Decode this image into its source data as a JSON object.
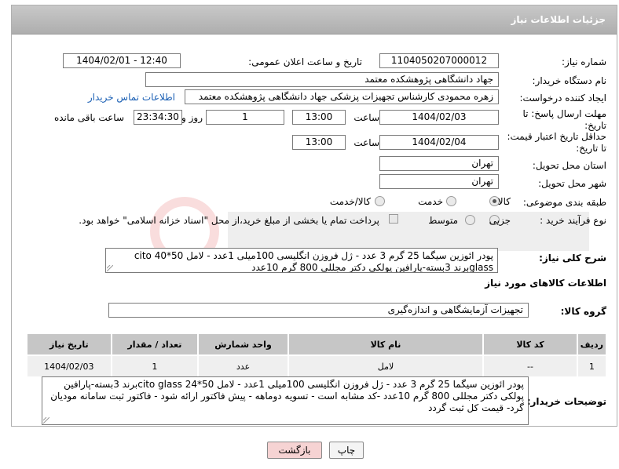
{
  "header": {
    "title": "جزئیات اطلاعات نیاز"
  },
  "form": {
    "need_number_label": "شماره نیاز:",
    "need_number": "1104050207000012",
    "announce_label": "تاریخ و ساعت اعلان عمومی:",
    "announce_value": "1404/02/01 - 12:40",
    "buyer_org_label": "نام دستگاه خریدار:",
    "buyer_org": "جهاد دانشگاهی پژوهشکده معتمد",
    "creator_label": "ایجاد کننده درخواست:",
    "creator": "زهره محمودی کارشناس تجهیزات پزشکی جهاد دانشگاهی پژوهشکده معتمد",
    "contact_link": "اطلاعات تماس خریدار",
    "deadline_label": "مهلت ارسال پاسخ: تا تاریخ:",
    "deadline_date": "1404/02/03",
    "time_label": "ساعت",
    "deadline_time": "13:00",
    "days_value": "1",
    "days_label": "روز و",
    "remaining_time": "23:34:30",
    "remaining_label": "ساعت باقی مانده",
    "validity_label": "حداقل تاریخ اعتبار قیمت: تا تاریخ:",
    "validity_date": "1404/02/04",
    "validity_time": "13:00",
    "province_label": "استان محل تحویل:",
    "province": "تهران",
    "city_label": "شهر محل تحویل:",
    "city": "تهران",
    "category_label": "طبقه بندی موضوعی:",
    "category_options": [
      "کالا",
      "خدمت",
      "کالا/خدمت"
    ],
    "process_label": "نوع فرآیند خرید :",
    "process_options": [
      "جزیی",
      "متوسط"
    ],
    "payment_note": "پرداخت تمام یا بخشی از مبلغ خرید،از محل \"اسناد خزانه اسلامی\" خواهد بود."
  },
  "summary": {
    "label": "شرح کلی نیاز:",
    "text": "پودر ائوزین سیگما 25 گرم 3 عدد - ژل فروزن انگلیسی 100میلی 1عدد - لامل 50*40 cito glassبرند 3بسته-پارافین پولکی دکتر مجللی 800 گرم 10عدد"
  },
  "goods": {
    "section_title": "اطلاعات کالاهای مورد نیاز",
    "group_label": "گروه کالا:",
    "group_value": "تجهیزات آزمایشگاهی و اندازه‌گیری",
    "columns": [
      "ردیف",
      "کد کالا",
      "نام کالا",
      "واحد شمارش",
      "تعداد / مقدار",
      "تاریخ نیاز"
    ],
    "rows": [
      [
        "1",
        "--",
        "لامل",
        "عدد",
        "1",
        "1404/02/03"
      ]
    ]
  },
  "buyer_notes": {
    "label": "توضیحات خریدار:",
    "text": "پودر ائوزین سیگما 25 گرم 3 عدد - ژل فروزن انگلیسی 100میلی 1عدد - لامل 50*24 cito glassبرند 3بسته-پارافین پولکی دکتر مجللی 800 گرم 10عدد -کد مشابه است - تسویه دوماهه - پیش فاکتور ارائه شود - فاکتور ثبت سامانه مودیان گرد- قیمت کل ثبت گردد"
  },
  "actions": {
    "print_label": "چاپ",
    "back_label": "بازگشت"
  },
  "colors": {
    "accent_link": "#1a5fb4",
    "header_bg": "#b8b8b8",
    "back_button_bg": "#f6d3d3"
  }
}
